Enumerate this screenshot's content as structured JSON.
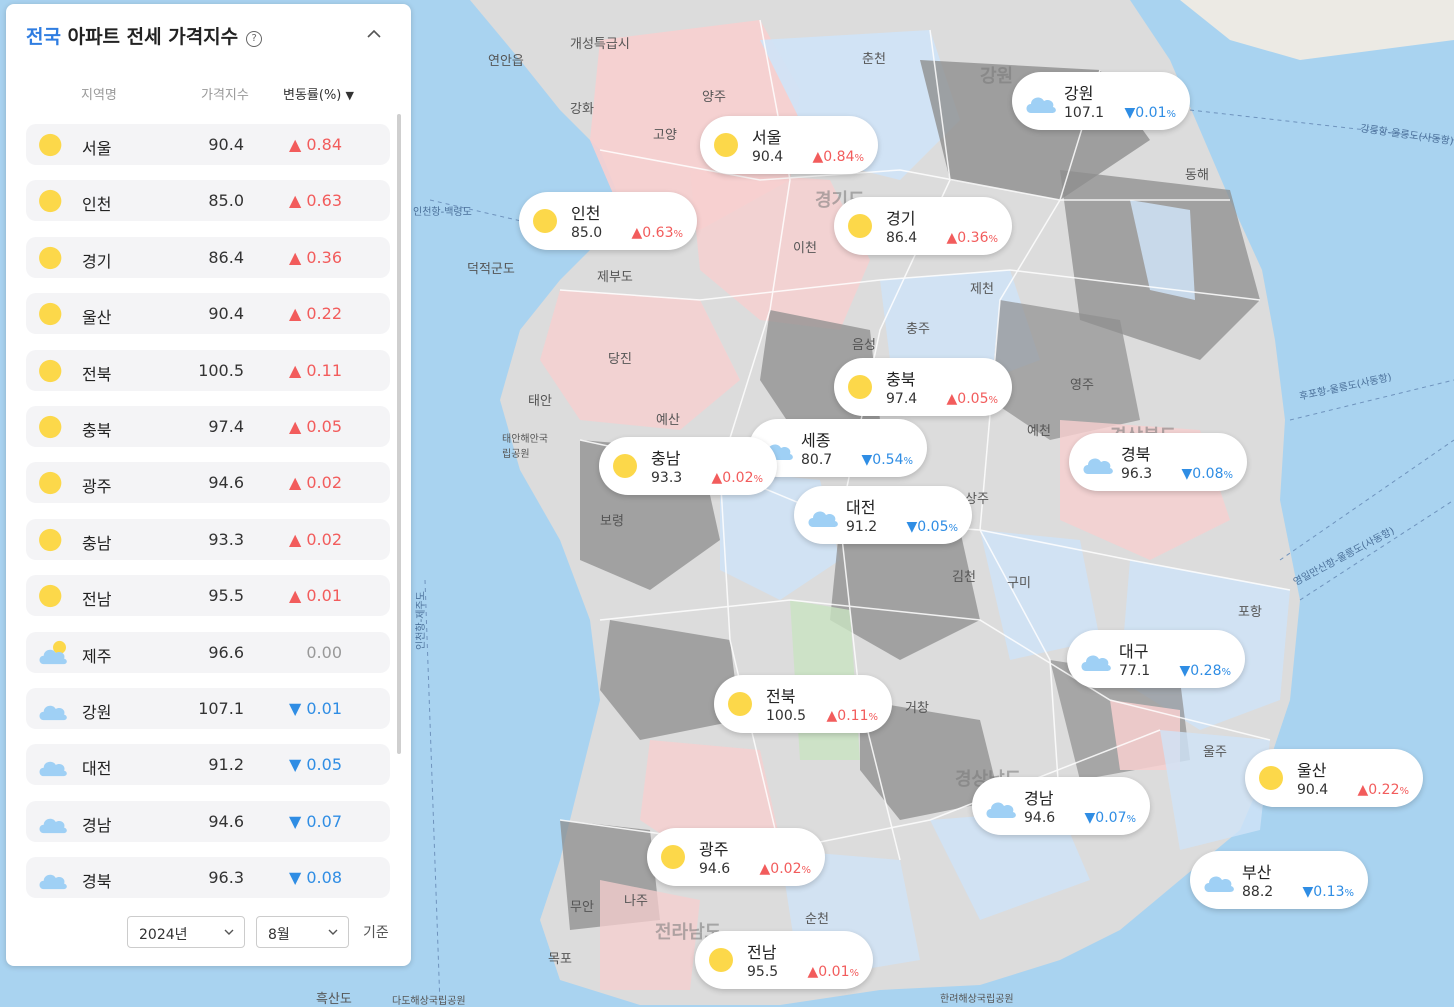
{
  "panel": {
    "title_scope": "전국",
    "title_rest": " 아파트 전세 가격지수",
    "help_glyph": "?",
    "headers": {
      "region": "지역명",
      "index": "가격지수",
      "change": "변동률(%)",
      "sort_glyph": "▼"
    },
    "rows": [
      {
        "name": "서울",
        "index": "90.4",
        "change": "0.84",
        "dir": "up",
        "weather": "sun"
      },
      {
        "name": "인천",
        "index": "85.0",
        "change": "0.63",
        "dir": "up",
        "weather": "sun"
      },
      {
        "name": "경기",
        "index": "86.4",
        "change": "0.36",
        "dir": "up",
        "weather": "sun"
      },
      {
        "name": "울산",
        "index": "90.4",
        "change": "0.22",
        "dir": "up",
        "weather": "sun"
      },
      {
        "name": "전북",
        "index": "100.5",
        "change": "0.11",
        "dir": "up",
        "weather": "sun"
      },
      {
        "name": "충북",
        "index": "97.4",
        "change": "0.05",
        "dir": "up",
        "weather": "sun"
      },
      {
        "name": "광주",
        "index": "94.6",
        "change": "0.02",
        "dir": "up",
        "weather": "sun"
      },
      {
        "name": "충남",
        "index": "93.3",
        "change": "0.02",
        "dir": "up",
        "weather": "sun"
      },
      {
        "name": "전남",
        "index": "95.5",
        "change": "0.01",
        "dir": "up",
        "weather": "sun"
      },
      {
        "name": "제주",
        "index": "96.6",
        "change": "0.00",
        "dir": "flat",
        "weather": "partly"
      },
      {
        "name": "강원",
        "index": "107.1",
        "change": "0.01",
        "dir": "down",
        "weather": "cloud"
      },
      {
        "name": "대전",
        "index": "91.2",
        "change": "0.05",
        "dir": "down",
        "weather": "cloud"
      },
      {
        "name": "경남",
        "index": "94.6",
        "change": "0.07",
        "dir": "down",
        "weather": "cloud"
      },
      {
        "name": "경북",
        "index": "96.3",
        "change": "0.08",
        "dir": "down",
        "weather": "cloud"
      }
    ],
    "year": "2024년",
    "month": "8월",
    "base_label": "기준"
  },
  "symbols": {
    "up": "▲",
    "down": "▼",
    "percent": "%"
  },
  "colors": {
    "up": "#f25c5c",
    "down": "#2f8de4",
    "sun": "#fcd84a",
    "cloud": "#9fd0f5",
    "accent": "#2f7de1"
  },
  "map": {
    "labels": [
      "개성특급시",
      "연안읍",
      "춘천",
      "강원",
      "동해",
      "영주",
      "예천",
      "김천",
      "구미",
      "포항",
      "울주",
      "거창",
      "순천",
      "무안",
      "나주",
      "목포",
      "흑산도",
      "제부도",
      "덕적군도",
      "당진",
      "예산",
      "보령",
      "태안",
      "충주",
      "제천",
      "음성",
      "이천",
      "상주",
      "양주",
      "강화",
      "고양",
      "태안해안국립공원",
      "한려해상국립공원",
      "다도해상국립공원",
      "경기도",
      "경상북도",
      "경상남도",
      "전라남도",
      "인천항-백령도",
      "강릉항-울릉도(사동항)",
      "후포항-울릉도(사동항)",
      "영일만신항-울릉도(사동항)",
      "인천항-제주도"
    ],
    "callouts": [
      {
        "name": "강원",
        "index": "107.1",
        "change": "0.01",
        "dir": "down",
        "weather": "cloud"
      },
      {
        "name": "서울",
        "index": "90.4",
        "change": "0.84",
        "dir": "up",
        "weather": "sun"
      },
      {
        "name": "인천",
        "index": "85.0",
        "change": "0.63",
        "dir": "up",
        "weather": "sun"
      },
      {
        "name": "경기",
        "index": "86.4",
        "change": "0.36",
        "dir": "up",
        "weather": "sun"
      },
      {
        "name": "충북",
        "index": "97.4",
        "change": "0.05",
        "dir": "up",
        "weather": "sun"
      },
      {
        "name": "세종",
        "index": "80.7",
        "change": "0.54",
        "dir": "down",
        "weather": "cloud"
      },
      {
        "name": "충남",
        "index": "93.3",
        "change": "0.02",
        "dir": "up",
        "weather": "sun"
      },
      {
        "name": "경북",
        "index": "96.3",
        "change": "0.08",
        "dir": "down",
        "weather": "cloud"
      },
      {
        "name": "대전",
        "index": "91.2",
        "change": "0.05",
        "dir": "down",
        "weather": "cloud"
      },
      {
        "name": "대구",
        "index": "77.1",
        "change": "0.28",
        "dir": "down",
        "weather": "cloud"
      },
      {
        "name": "전북",
        "index": "100.5",
        "change": "0.11",
        "dir": "up",
        "weather": "sun"
      },
      {
        "name": "울산",
        "index": "90.4",
        "change": "0.22",
        "dir": "up",
        "weather": "sun"
      },
      {
        "name": "경남",
        "index": "94.6",
        "change": "0.07",
        "dir": "down",
        "weather": "cloud"
      },
      {
        "name": "광주",
        "index": "94.6",
        "change": "0.02",
        "dir": "up",
        "weather": "sun"
      },
      {
        "name": "부산",
        "index": "88.2",
        "change": "0.13",
        "dir": "down",
        "weather": "cloud"
      },
      {
        "name": "전남",
        "index": "95.5",
        "change": "0.01",
        "dir": "up",
        "weather": "sun"
      }
    ]
  }
}
